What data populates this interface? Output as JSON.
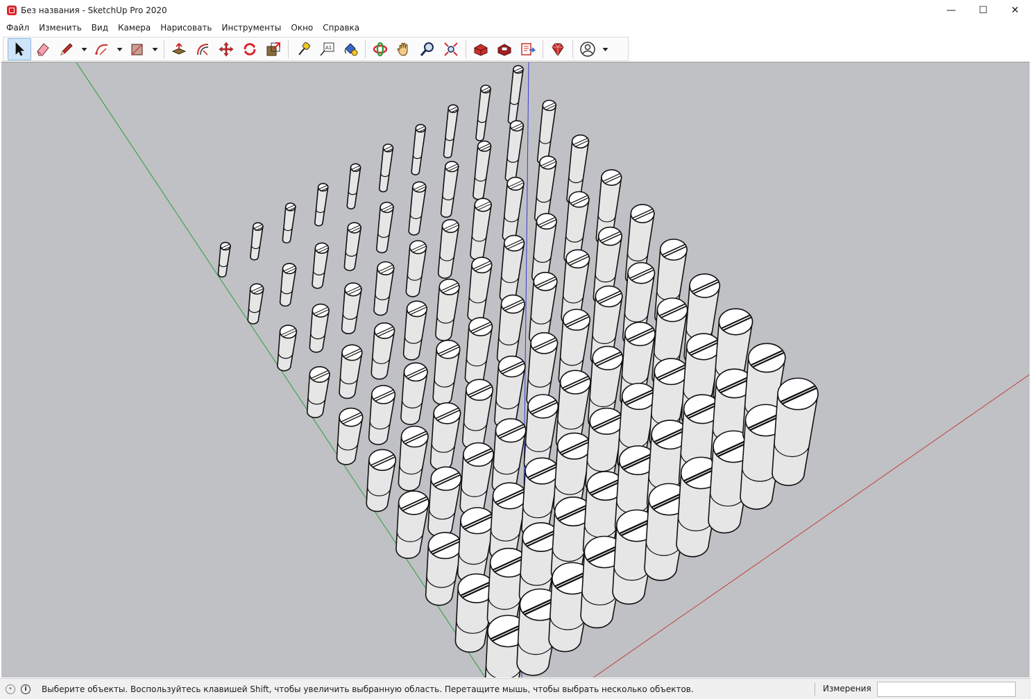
{
  "window": {
    "title": "Без названия - SketchUp Pro 2020",
    "controls": {
      "minimize": "—",
      "maximize": "☐",
      "close": "✕"
    }
  },
  "menu": {
    "items": [
      "Файл",
      "Изменить",
      "Вид",
      "Камера",
      "Нарисовать",
      "Инструменты",
      "Окно",
      "Справка"
    ]
  },
  "toolbar": {
    "tools": [
      {
        "name": "select-tool",
        "icon": "arrow-cursor-icon",
        "active": true
      },
      {
        "name": "eraser-tool",
        "icon": "eraser-icon"
      },
      {
        "name": "line-tool",
        "icon": "pencil-icon"
      },
      {
        "name": "arc-tool",
        "icon": "arc-icon"
      },
      {
        "name": "shape-tool",
        "icon": "rectangle-icon"
      },
      {
        "name": "push-pull-tool",
        "icon": "push-pull-icon"
      },
      {
        "name": "offset-tool",
        "icon": "offset-icon"
      },
      {
        "name": "move-tool",
        "icon": "move-icon"
      },
      {
        "name": "rotate-tool",
        "icon": "rotate-icon"
      },
      {
        "name": "scale-tool",
        "icon": "scale-icon"
      },
      {
        "name": "tape-measure-tool",
        "icon": "tape-measure-icon"
      },
      {
        "name": "text-tool",
        "icon": "text-icon"
      },
      {
        "name": "paint-bucket-tool",
        "icon": "paint-bucket-icon"
      },
      {
        "name": "orbit-tool",
        "icon": "orbit-icon"
      },
      {
        "name": "pan-tool",
        "icon": "hand-icon"
      },
      {
        "name": "zoom-tool",
        "icon": "zoom-icon"
      },
      {
        "name": "zoom-extents-tool",
        "icon": "zoom-extents-icon"
      },
      {
        "name": "warehouse-tool",
        "icon": "warehouse-icon"
      },
      {
        "name": "extension-warehouse-tool",
        "icon": "extension-warehouse-icon"
      },
      {
        "name": "layout-tool",
        "icon": "send-to-layout-icon"
      },
      {
        "name": "extension-manager-tool",
        "icon": "ruby-gem-icon"
      },
      {
        "name": "account-tool",
        "icon": "user-icon"
      }
    ],
    "text_tool_label": "A1"
  },
  "status": {
    "message": "Выберите объекты. Воспользуйтесь клавишей Shift, чтобы увеличить выбранную область. Перетащите мышь, чтобы выбрать несколько объектов.",
    "info_icon": "i",
    "measurements_label": "Измерения",
    "measurements_value": ""
  },
  "colors": {
    "viewport_bg": "#c0c1c5",
    "axis_green": "#2f9a3a",
    "axis_red": "#c0403f",
    "axis_blue": "#3a3ad0",
    "select_active_bg": "#cfe4f8",
    "brand_red": "#d8262c"
  }
}
